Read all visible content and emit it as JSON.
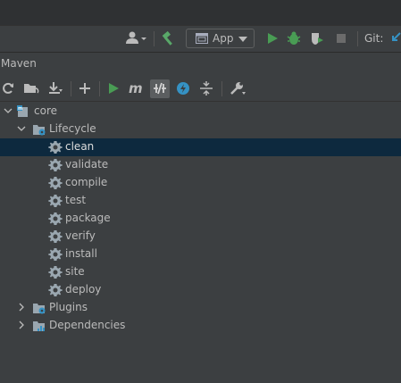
{
  "toolbar": {
    "run_config": "App",
    "git_label": "Git:"
  },
  "maven": {
    "title": "Maven"
  },
  "tree": {
    "project": "core",
    "lifecycle": {
      "label": "Lifecycle",
      "goals": [
        "clean",
        "validate",
        "compile",
        "test",
        "package",
        "verify",
        "install",
        "site",
        "deploy"
      ]
    },
    "plugins": "Plugins",
    "dependencies": "Dependencies"
  },
  "colors": {
    "background": "#3c3f41",
    "selection": "#0d293e",
    "run_green": "#499c54",
    "build_green": "#59a869",
    "blue_accent": "#3592c4"
  }
}
